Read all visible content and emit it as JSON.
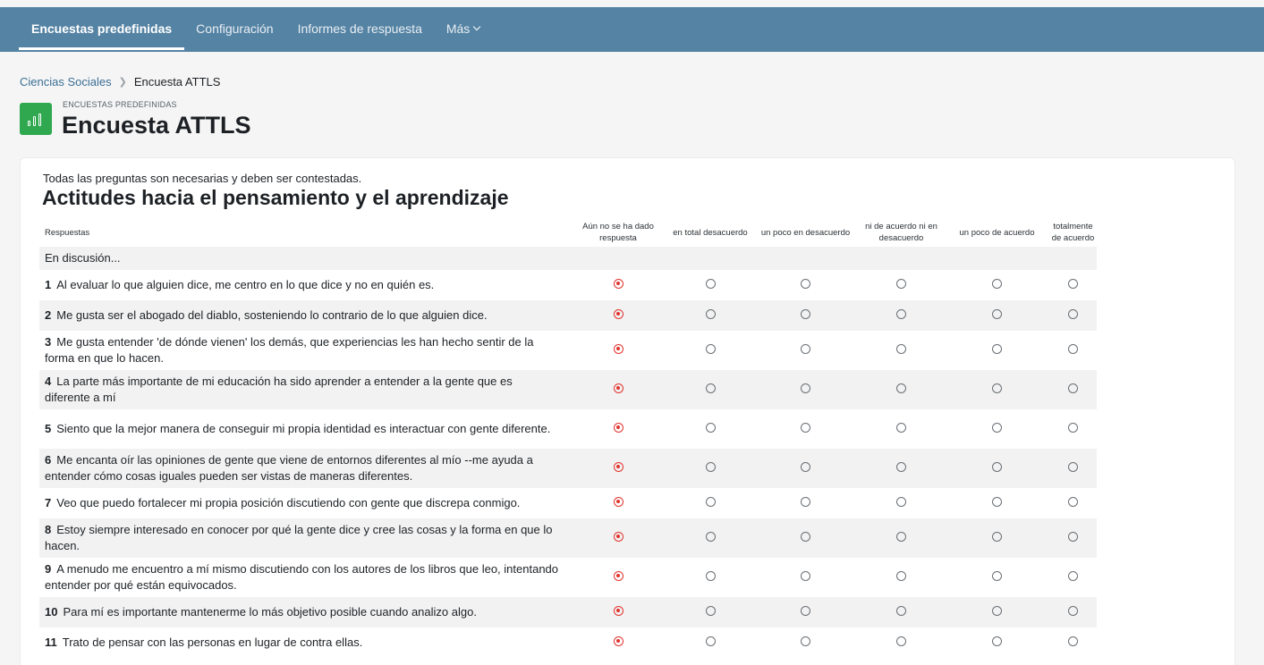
{
  "nav": {
    "items": [
      {
        "label": "Encuestas predefinidas",
        "active": true
      },
      {
        "label": "Configuración",
        "active": false
      },
      {
        "label": "Informes de respuesta",
        "active": false
      },
      {
        "label": "Más",
        "active": false
      }
    ]
  },
  "breadcrumb": {
    "parent": "Ciencias Sociales",
    "current": "Encuesta ATTLS"
  },
  "header": {
    "kicker": "ENCUESTAS PREDEFINIDAS",
    "title": "Encuesta ATTLS",
    "icon": "survey-chart-icon"
  },
  "survey": {
    "instructions": "Todas las preguntas son necesarias y deben ser contestadas.",
    "section_title": "Actitudes hacia el pensamiento y el aprendizaje",
    "columns": {
      "responses": "Respuestas",
      "options": [
        "Aún no se ha dado respuesta",
        "en total desacuerdo",
        "un poco en desacuerdo",
        "ni de acuerdo ni en desacuerdo",
        "un poco de acuerdo",
        "totalmente de acuerdo"
      ]
    },
    "group_label": "En discusión...",
    "questions": [
      {
        "num": "1",
        "text": "Al evaluar lo que alguien dice, me centro en lo que dice y no en quién es.",
        "selected": 0
      },
      {
        "num": "2",
        "text": "Me gusta ser el abogado del diablo, sosteniendo lo contrario de lo que alguien dice.",
        "selected": 0
      },
      {
        "num": "3",
        "text": "Me gusta entender 'de dónde vienen' los demás, que experiencias les han hecho sentir de la forma en que lo hacen.",
        "selected": 0
      },
      {
        "num": "4",
        "text": "La parte más importante de mi educación ha sido aprender a entender a la gente que es diferente a mí",
        "selected": 0
      },
      {
        "num": "5",
        "text": "Siento que la mejor manera de conseguir mi propia identidad es interactuar con gente diferente.",
        "selected": 0
      },
      {
        "num": "6",
        "text": "Me encanta oír las opiniones de gente que viene de entornos diferentes al mío --me ayuda a entender cómo cosas iguales pueden ser vistas de maneras diferentes.",
        "selected": 0
      },
      {
        "num": "7",
        "text": "Veo que puedo fortalecer mi propia posición discutiendo con gente que discrepa conmigo.",
        "selected": 0
      },
      {
        "num": "8",
        "text": "Estoy siempre interesado en conocer por qué la gente dice y cree las cosas y la forma en que lo hacen.",
        "selected": 0
      },
      {
        "num": "9",
        "text": "A menudo me encuentro a mí mismo discutiendo con los autores de los libros que leo, intentando entender por qué están equivocados.",
        "selected": 0
      },
      {
        "num": "10",
        "text": "Para mí es importante mantenerme lo más objetivo posible cuando analizo algo.",
        "selected": 0
      },
      {
        "num": "11",
        "text": "Trato de pensar con las personas en lugar de contra ellas.",
        "selected": 0
      }
    ]
  },
  "colors": {
    "navbar": "#5583a4",
    "accent_radio": "#e0342f",
    "link": "#3a6f95",
    "module_icon": "#2fa84f"
  }
}
